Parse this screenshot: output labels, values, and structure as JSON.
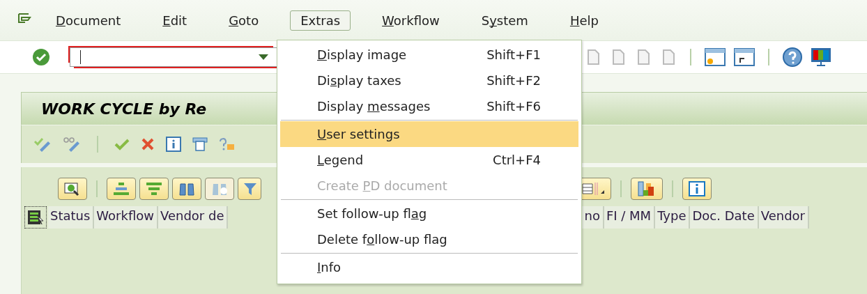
{
  "menu_bar": [
    {
      "parts": [
        {
          "text": "D",
          "mnemonic": true
        },
        {
          "text": "ocument",
          "mnemonic": false
        }
      ],
      "selected": false
    },
    {
      "parts": [
        {
          "text": "E",
          "mnemonic": true
        },
        {
          "text": "dit",
          "mnemonic": false
        }
      ],
      "selected": false
    },
    {
      "parts": [
        {
          "text": "G",
          "mnemonic": true
        },
        {
          "text": "oto",
          "mnemonic": false
        }
      ],
      "selected": false
    },
    {
      "parts": [
        {
          "text": "Extras",
          "mnemonic": false
        }
      ],
      "selected": true
    },
    {
      "parts": [
        {
          "text": "W",
          "mnemonic": true
        },
        {
          "text": "orkflow",
          "mnemonic": false
        }
      ],
      "selected": false
    },
    {
      "parts": [
        {
          "text": "S",
          "mnemonic": false
        },
        {
          "text": "y",
          "mnemonic": true
        },
        {
          "text": "stem",
          "mnemonic": false
        }
      ],
      "selected": false
    },
    {
      "parts": [
        {
          "text": "H",
          "mnemonic": true
        },
        {
          "text": "elp",
          "mnemonic": false
        }
      ],
      "selected": false
    }
  ],
  "dropdown": [
    {
      "kind": "item",
      "parts": [
        {
          "text": "D",
          "mnemonic": true
        },
        {
          "text": "isplay image",
          "mnemonic": false
        }
      ],
      "shortcut": "Shift+F1",
      "selected": false,
      "disabled": false
    },
    {
      "kind": "item",
      "parts": [
        {
          "text": "Di",
          "mnemonic": false
        },
        {
          "text": "s",
          "mnemonic": true
        },
        {
          "text": "play taxes",
          "mnemonic": false
        }
      ],
      "shortcut": "Shift+F2",
      "selected": false,
      "disabled": false
    },
    {
      "kind": "item",
      "parts": [
        {
          "text": "Display ",
          "mnemonic": false
        },
        {
          "text": "m",
          "mnemonic": true
        },
        {
          "text": "essages",
          "mnemonic": false
        }
      ],
      "shortcut": "Shift+F6",
      "selected": false,
      "disabled": false
    },
    {
      "kind": "separator"
    },
    {
      "kind": "item",
      "parts": [
        {
          "text": "U",
          "mnemonic": true
        },
        {
          "text": "ser settings",
          "mnemonic": false
        }
      ],
      "selected": true,
      "disabled": false
    },
    {
      "kind": "item",
      "parts": [
        {
          "text": "L",
          "mnemonic": true
        },
        {
          "text": "egend",
          "mnemonic": false
        }
      ],
      "shortcut": "Ctrl+F4",
      "selected": false,
      "disabled": false
    },
    {
      "kind": "item",
      "parts": [
        {
          "text": "Create ",
          "mnemonic": false
        },
        {
          "text": "P",
          "mnemonic": true
        },
        {
          "text": "D document",
          "mnemonic": false
        }
      ],
      "selected": false,
      "disabled": true
    },
    {
      "kind": "separator"
    },
    {
      "kind": "item",
      "parts": [
        {
          "text": "Set follow-up fl",
          "mnemonic": false
        },
        {
          "text": "a",
          "mnemonic": true
        },
        {
          "text": "g",
          "mnemonic": false
        }
      ],
      "selected": false,
      "disabled": false
    },
    {
      "kind": "item",
      "parts": [
        {
          "text": "Delete f",
          "mnemonic": false
        },
        {
          "text": "o",
          "mnemonic": true
        },
        {
          "text": "llow-up flag",
          "mnemonic": false
        }
      ],
      "selected": false,
      "disabled": false
    },
    {
      "kind": "separator"
    },
    {
      "kind": "item",
      "parts": [
        {
          "text": "I",
          "mnemonic": true
        },
        {
          "text": "nfo",
          "mnemonic": false
        }
      ],
      "selected": false,
      "disabled": false
    }
  ],
  "screen_title": "WORK CYCLE by Re",
  "grid": {
    "columns_left": [
      "Status",
      "Workflow",
      "Vendor de"
    ],
    "columns_right": [
      "no",
      "FI / MM",
      "Type",
      "Doc. Date",
      "Vendor"
    ]
  }
}
